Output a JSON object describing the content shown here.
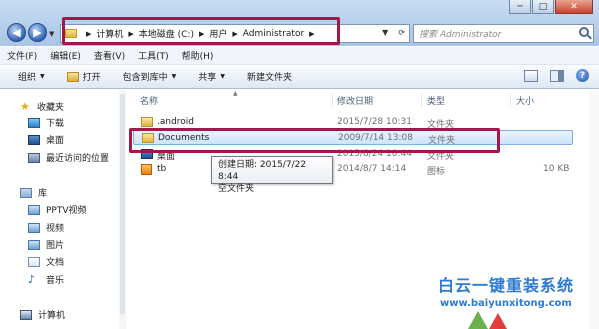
{
  "window": {
    "controls": [
      "─",
      "□",
      "✕"
    ]
  },
  "address": {
    "breadcrumb": [
      "计算机",
      "本地磁盘 (C:)",
      "用户",
      "Administrator"
    ],
    "search_placeholder": "搜索 Administrator"
  },
  "menubar": [
    "文件(F)",
    "编辑(E)",
    "查看(V)",
    "工具(T)",
    "帮助(H)"
  ],
  "commandbar": {
    "organize": "组织",
    "open": "打开",
    "include_in_library": "包含到库中",
    "share": "共享",
    "new_folder": "新建文件夹"
  },
  "navpane": {
    "favorites": "收藏夹",
    "downloads": "下载",
    "desktop": "桌面",
    "recent": "最近访问的位置",
    "libraries": "库",
    "pptv": "PPTV视频",
    "videos": "视频",
    "pictures": "图片",
    "documents": "文档",
    "music": "音乐",
    "computer": "计算机"
  },
  "columns": {
    "name": "名称",
    "modified": "修改日期",
    "type": "类型",
    "size": "大小"
  },
  "files": [
    {
      "name": ".android",
      "modified": "2015/7/28 10:31",
      "type": "文件夹",
      "size": ""
    },
    {
      "name": "Documents",
      "modified": "2009/7/14 13:08",
      "type": "文件夹",
      "size": ""
    },
    {
      "name": "桌面",
      "modified": "2015/8/24 10:44",
      "type": "文件夹",
      "size": ""
    },
    {
      "name": "tb",
      "modified": "2014/8/7 14:14",
      "type": "图标",
      "size": "10 KB"
    }
  ],
  "tooltip": {
    "created": "创建日期: 2015/7/22 8:44",
    "desc": "空文件夹"
  },
  "watermark": {
    "title": "白云一键重装系统",
    "url": "www.baiyunxitong.com"
  },
  "colors": {
    "highlight_border": "#a3174a",
    "selection": "#cde4fc"
  }
}
